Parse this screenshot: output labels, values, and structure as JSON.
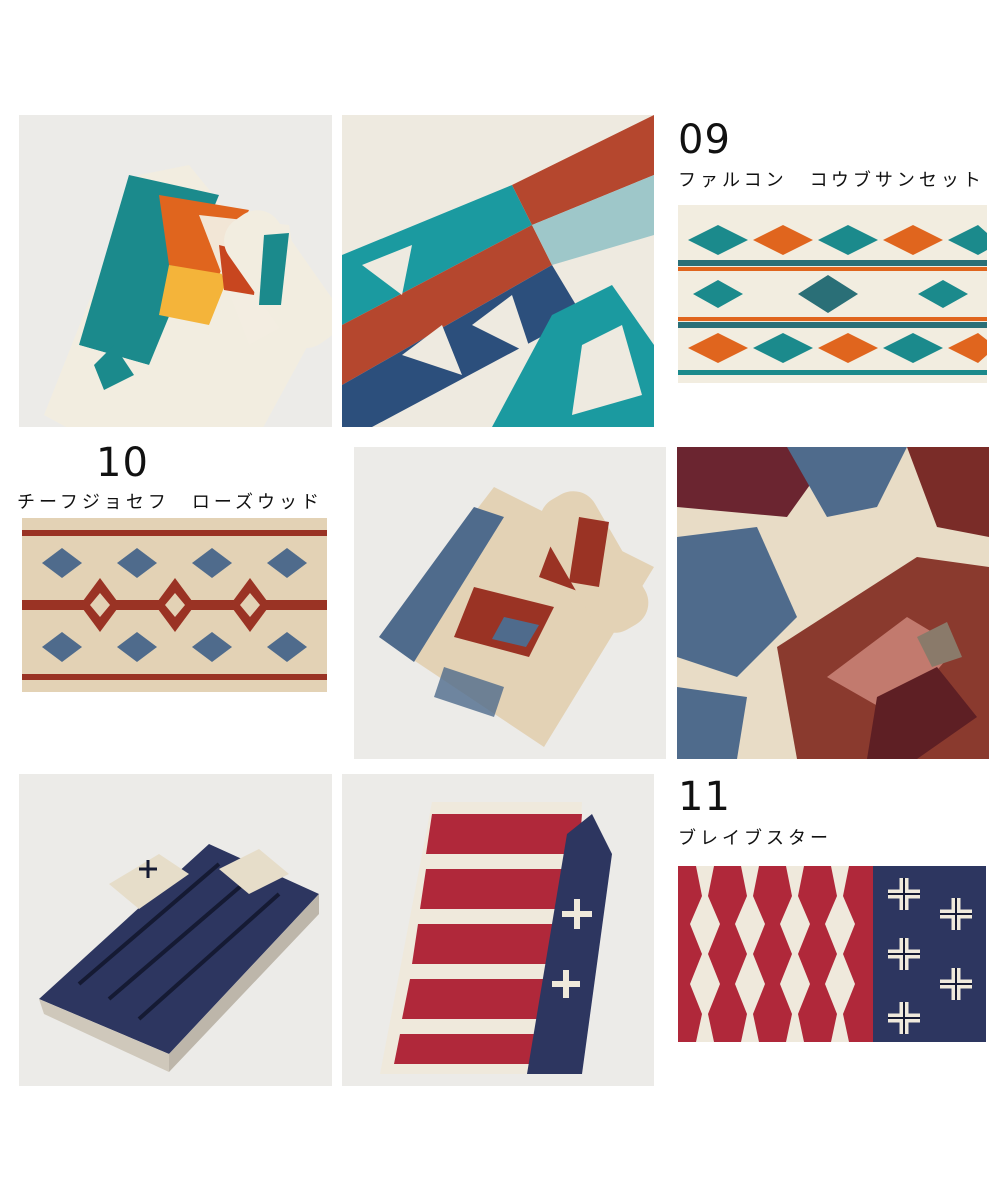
{
  "products": [
    {
      "number": "09",
      "name": "ファルコン　コウブサンセット"
    },
    {
      "number": "10",
      "name": "チーフジョセフ　ローズウッド"
    },
    {
      "number": "11",
      "name": "ブレイブスター"
    }
  ],
  "photos": [
    {
      "name": "falcon-cove-rolled-towel-photo"
    },
    {
      "name": "falcon-cove-closeup-photo"
    },
    {
      "name": "falcon-cove-flat-towel-photo"
    },
    {
      "name": "chief-joseph-flat-towel-photo"
    },
    {
      "name": "chief-joseph-rolled-towel-photo"
    },
    {
      "name": "chief-joseph-closeup-photo"
    },
    {
      "name": "brave-star-folded-towel-photo"
    },
    {
      "name": "brave-star-draped-towel-photo"
    },
    {
      "name": "brave-star-flat-towel-photo"
    }
  ],
  "colors": {
    "background": "#ffffff",
    "photo_backdrop": "#e9e7e4",
    "falcon_teal": "#1b8a8c",
    "falcon_orange": "#e0651e",
    "falcon_cream": "#f2ede0",
    "chief_tan": "#e3d2b5",
    "chief_red": "#9a3324",
    "chief_blue": "#4f6b8c",
    "brave_red": "#b0283a",
    "brave_navy": "#2d3660",
    "brave_cream": "#efe9dc"
  }
}
